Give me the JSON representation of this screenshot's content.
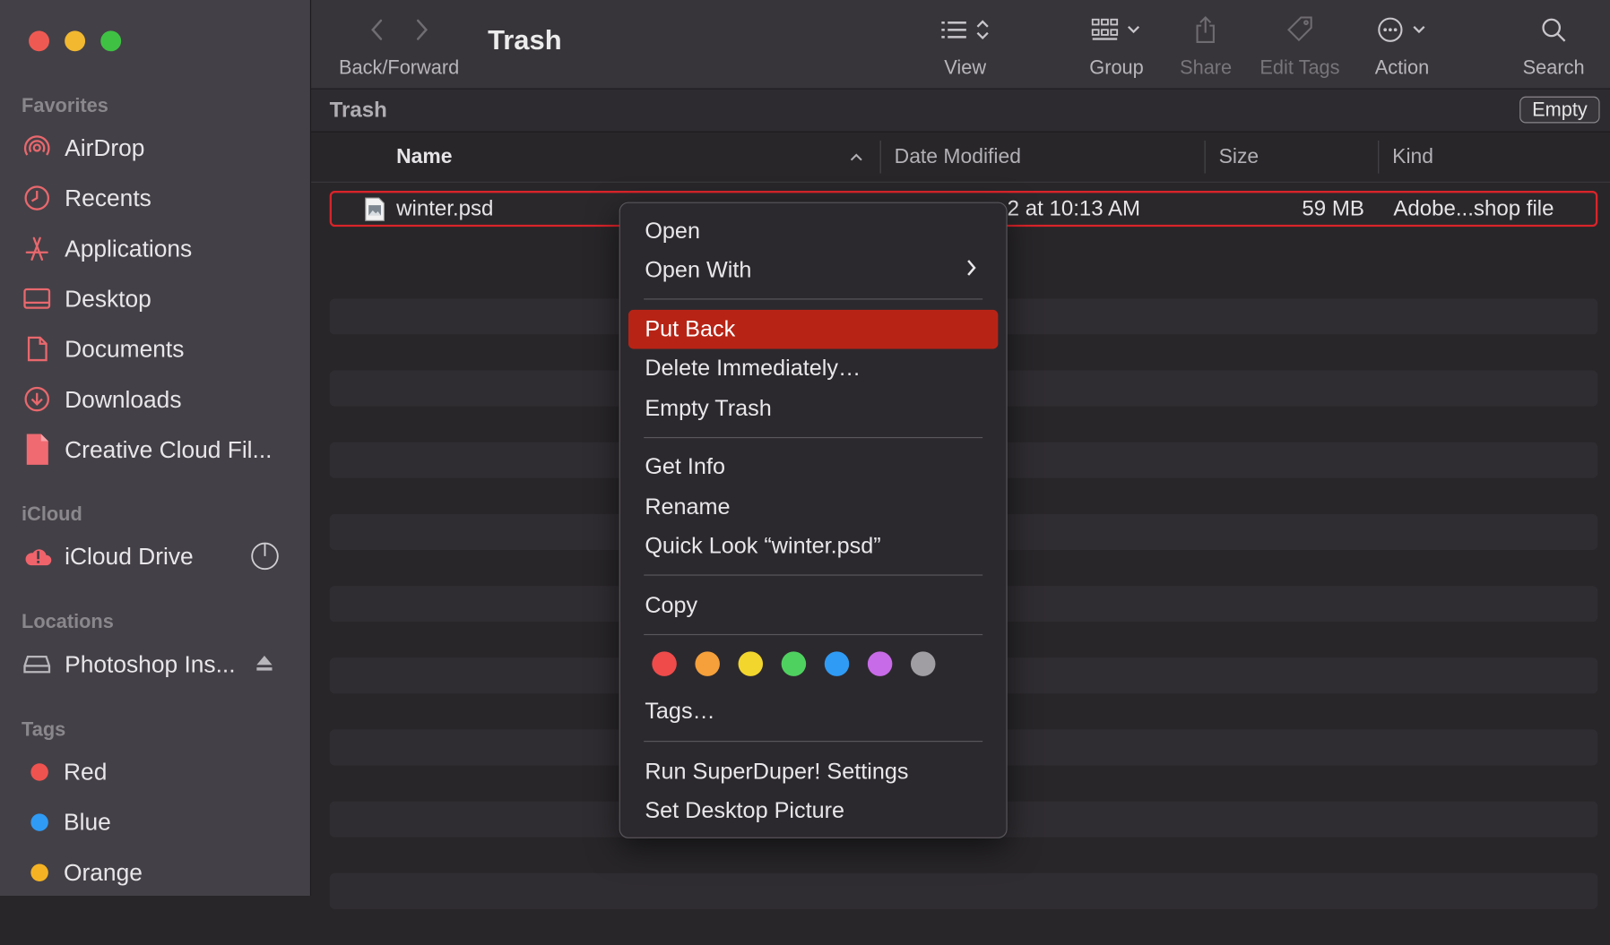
{
  "window": {
    "title": "Trash",
    "path_title": "Trash",
    "empty_button": "Empty"
  },
  "toolbar": {
    "back_forward": "Back/Forward",
    "view": "View",
    "group": "Group",
    "share": "Share",
    "edit_tags": "Edit Tags",
    "action": "Action",
    "search": "Search"
  },
  "sidebar": {
    "favorites_header": "Favorites",
    "favorites": [
      {
        "label": "AirDrop",
        "icon": "airdrop-icon"
      },
      {
        "label": "Recents",
        "icon": "clock-icon"
      },
      {
        "label": "Applications",
        "icon": "applications-icon"
      },
      {
        "label": "Desktop",
        "icon": "desktop-icon"
      },
      {
        "label": "Documents",
        "icon": "document-icon"
      },
      {
        "label": "Downloads",
        "icon": "download-icon"
      },
      {
        "label": "Creative Cloud Fil...",
        "icon": "creative-cloud-file-icon"
      }
    ],
    "icloud_header": "iCloud",
    "icloud": [
      {
        "label": "iCloud Drive",
        "icon": "icloud-warning-icon"
      }
    ],
    "locations_header": "Locations",
    "locations": [
      {
        "label": "Photoshop Ins...",
        "icon": "disk-icon"
      }
    ],
    "tags_header": "Tags",
    "tags": [
      {
        "label": "Red",
        "color": "#ef5350"
      },
      {
        "label": "Blue",
        "color": "#2f9bf5"
      },
      {
        "label": "Orange",
        "color": "#f5b324"
      }
    ]
  },
  "columns": {
    "name": "Name",
    "date_modified": "Date Modified",
    "size": "Size",
    "kind": "Kind"
  },
  "files": [
    {
      "name": "winter.psd",
      "date_modified": "2 at 10:13 AM",
      "size": "59 MB",
      "kind": "Adobe...shop file"
    }
  ],
  "context_menu": {
    "open": "Open",
    "open_with": "Open With",
    "put_back": "Put Back",
    "delete_immediately": "Delete Immediately…",
    "empty_trash": "Empty Trash",
    "get_info": "Get Info",
    "rename": "Rename",
    "quick_look": "Quick Look “winter.psd”",
    "copy": "Copy",
    "tags": "Tags…",
    "run_superduper": "Run SuperDuper! Settings",
    "set_desktop_picture": "Set Desktop Picture",
    "tag_colors": [
      "#ef4b4b",
      "#f5a03a",
      "#f2d62e",
      "#4fd160",
      "#2f9bf5",
      "#c86be8",
      "#a09ea2"
    ]
  }
}
